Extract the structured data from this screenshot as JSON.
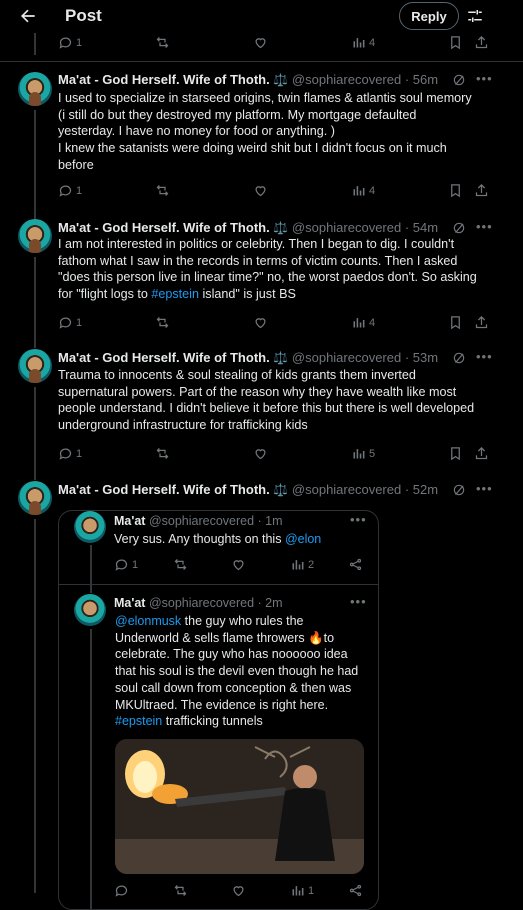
{
  "header": {
    "title": "Post",
    "reply_label": "Reply"
  },
  "top_actions": {
    "replies": "1",
    "views": "4"
  },
  "posts": [
    {
      "author": "Ma'at - God Herself. Wife of Thoth.",
      "emoji": "⚖️",
      "handle": "@sophiarecovered",
      "time": "56m",
      "text_lines": [
        "I used to specialize in starseed origins, twin flames & atlantis soul memory",
        "(i still do but they destroyed my platform.  My mortgage defaulted",
        "yesterday.  I have no money for food or anything. )",
        "I knew the satanists were doing weird shit but I didn't focus on it much",
        "before"
      ],
      "replies": "1",
      "views": "4"
    },
    {
      "author": "Ma'at - God Herself. Wife of Thoth.",
      "emoji": "⚖️",
      "handle": "@sophiarecovered",
      "time": "54m",
      "text_lines": [
        "I am not interested in politics or celebrity. Then I began to dig. I couldn't",
        "fathom what I saw in the records in terms of victim counts. Then I asked",
        "\"does this person live in linear time?\" no, the worst paedos don't. So asking"
      ],
      "last_line_pre": "for \"flight logs to ",
      "last_line_tag": "#epstein",
      "last_line_post": " island\" is just BS",
      "replies": "1",
      "views": "4"
    },
    {
      "author": "Ma'at - God Herself. Wife of Thoth.",
      "emoji": "⚖️",
      "handle": "@sophiarecovered",
      "time": "53m",
      "text_lines": [
        "Trauma to innocents & soul stealing of kids grants them inverted",
        "supernatural powers. Part of the reason why they have wealth like most",
        "people understand. I didn't believe it before this but there is well developed",
        "underground infrastructure for trafficking kids"
      ],
      "replies": "1",
      "views": "5"
    },
    {
      "author": "Ma'at - God Herself. Wife of Thoth.",
      "emoji": "⚖️",
      "handle": "@sophiarecovered",
      "time": "52m"
    }
  ],
  "quote1": {
    "author": "Ma'at",
    "handle": "@sophiarecovered",
    "time": "1m",
    "text_pre": "Very sus.  Any thoughts on this ",
    "mention": "@elon",
    "replies": "1",
    "views": "2"
  },
  "quote2": {
    "author": "Ma'at",
    "handle": "@sophiarecovered",
    "time": "2m",
    "line1_mention": "@elonmusk",
    "line1_rest": " the guy who rules the",
    "line2": "Underworld & sells flame throwers 🔥to",
    "line3": "celebrate.  The guy who has noooooo idea",
    "line4": "that his soul is the devil even though he had",
    "line5": "soul call down from conception & then was",
    "line6": "MKUltraed. The evidence is right here.",
    "line7_tag": "#epstein",
    "line7_rest": " trafficking tunnels",
    "views": "1"
  }
}
